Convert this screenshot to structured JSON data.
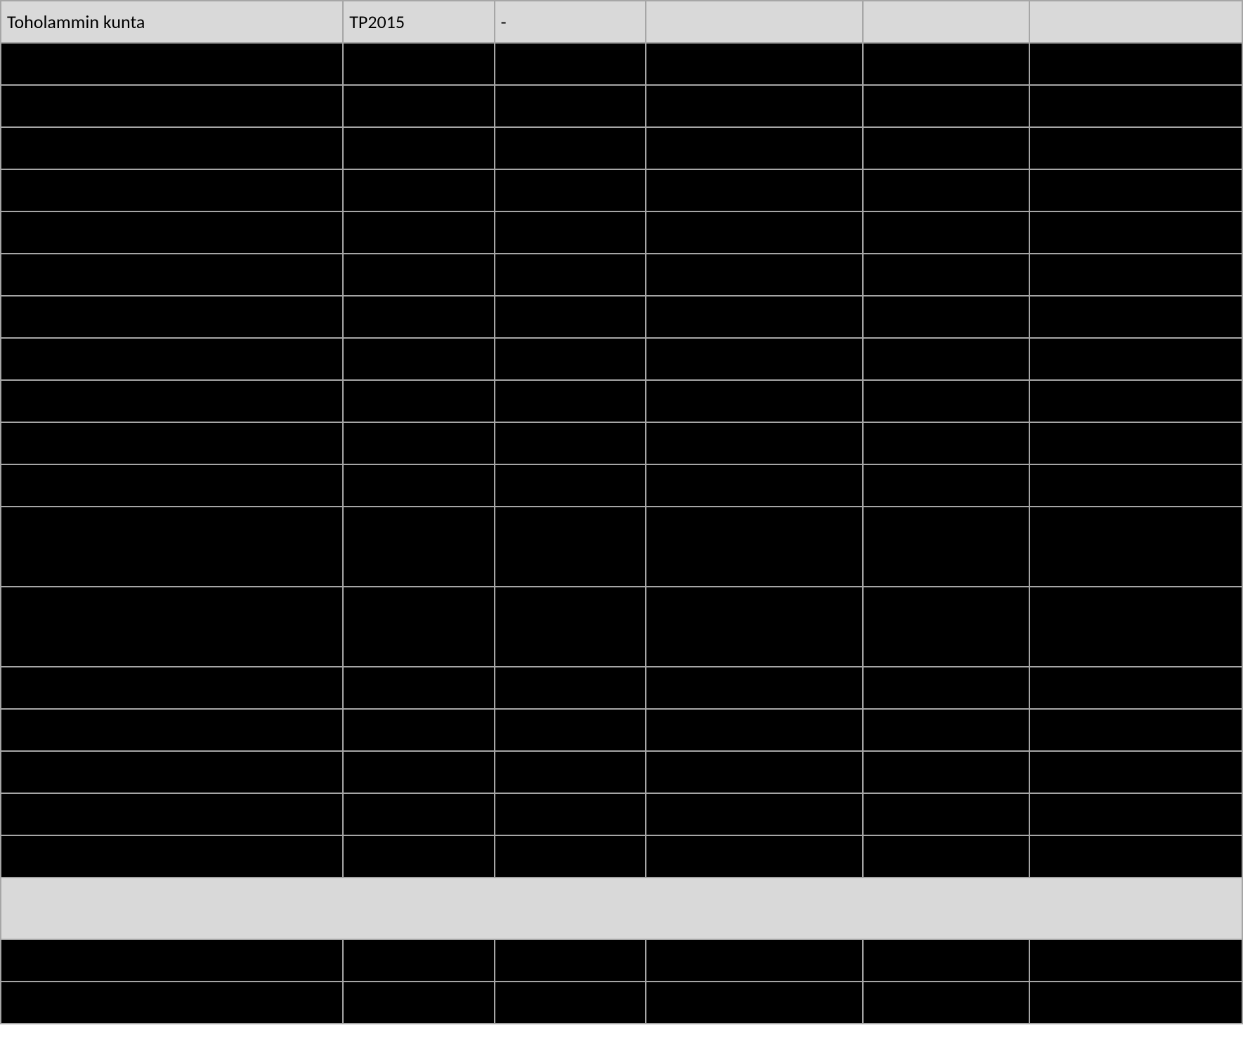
{
  "header": {
    "c0": "Toholammin kunta",
    "c1": "TP2015",
    "c2": "-",
    "c3": "",
    "c4": "",
    "c5": ""
  },
  "rows": [
    {
      "c0": "",
      "c1": "",
      "c2": "",
      "c3": "",
      "c4": "",
      "c5": ""
    },
    {
      "c0": "",
      "c1": "",
      "c2": "",
      "c3": "",
      "c4": "",
      "c5": ""
    },
    {
      "c0": "",
      "c1": "",
      "c2": "",
      "c3": "",
      "c4": "",
      "c5": ""
    },
    {
      "c0": "",
      "c1": "",
      "c2": "",
      "c3": "",
      "c4": "",
      "c5": ""
    },
    {
      "c0": "",
      "c1": "",
      "c2": "",
      "c3": "",
      "c4": "",
      "c5": ""
    },
    {
      "c0": "",
      "c1": "",
      "c2": "",
      "c3": "",
      "c4": "",
      "c5": ""
    },
    {
      "c0": "",
      "c1": "",
      "c2": "",
      "c3": "",
      "c4": "",
      "c5": ""
    },
    {
      "c0": "",
      "c1": "",
      "c2": "",
      "c3": "",
      "c4": "",
      "c5": ""
    },
    {
      "c0": "",
      "c1": "",
      "c2": "",
      "c3": "",
      "c4": "",
      "c5": ""
    },
    {
      "c0": "",
      "c1": "",
      "c2": "",
      "c3": "",
      "c4": "",
      "c5": ""
    },
    {
      "c0": "",
      "c1": "",
      "c2": "",
      "c3": "",
      "c4": "",
      "c5": ""
    },
    {
      "c0": "",
      "c1": "",
      "c2": "",
      "c3": "",
      "c4": "",
      "c5": "",
      "tall": true
    },
    {
      "c0": "",
      "c1": "",
      "c2": "",
      "c3": "",
      "c4": "",
      "c5": "",
      "tall": true
    },
    {
      "c0": "",
      "c1": "",
      "c2": "",
      "c3": "",
      "c4": "",
      "c5": ""
    },
    {
      "c0": "",
      "c1": "",
      "c2": "",
      "c3": "",
      "c4": "",
      "c5": ""
    },
    {
      "c0": "",
      "c1": "",
      "c2": "",
      "c3": "",
      "c4": "",
      "c5": ""
    },
    {
      "c0": "",
      "c1": "",
      "c2": "",
      "c3": "",
      "c4": "",
      "c5": ""
    },
    {
      "c0": "",
      "c1": "",
      "c2": "",
      "c3": "",
      "c4": "",
      "c5": ""
    }
  ],
  "rows2": [
    {
      "c0": "",
      "c1": "",
      "c2": "",
      "c3": "",
      "c4": "",
      "c5": ""
    },
    {
      "c0": "",
      "c1": "",
      "c2": "",
      "c3": "",
      "c4": "",
      "c5": ""
    }
  ]
}
